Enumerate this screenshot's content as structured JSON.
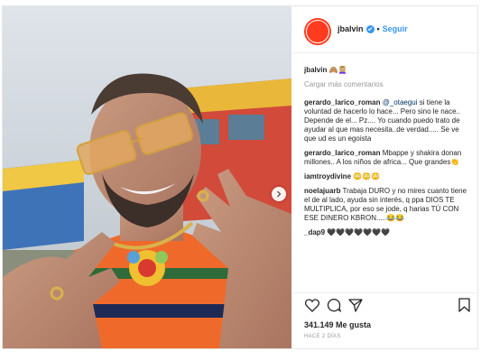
{
  "header": {
    "username": "jbalvin",
    "separator": "•",
    "follow_label": "Seguir"
  },
  "caption": {
    "username": "jbalvin",
    "text": "🙈💆🏼‍♀️"
  },
  "load_more_label": "Cargar más comentarios",
  "comments": [
    {
      "username": "gerardo_larico_roman",
      "mention": "@_otaegui",
      "text": "si tiene la voluntad de hacerlo lo hace... Pero sino le nace.. Depende de el... Pz.... Yo cuando puedo trato de ayudar al que mas necesita..de verdad..... Se ve que ud es un egoista"
    },
    {
      "username": "gerardo_larico_roman",
      "mention": "",
      "text": "Mbappe y shakira donan millones.. A los niños de africa... Que grandes👏"
    },
    {
      "username": "iamtroydivine",
      "mention": "",
      "text": "😳😳😳"
    },
    {
      "username": "noelajuarb",
      "mention": "",
      "text": "Trabaja DURO y no mires cuanto tiene el de al lado, ayuda sin interés, q ppa DIOS TE MULTIPLICA, por eso se jode, q harias TÚ CON ESE DINERO KBRON.....😂😂"
    },
    {
      "username": "_dap9",
      "mention": "",
      "text": "🖤🖤🖤🖤🖤🖤🖤"
    }
  ],
  "likes": "341.149 Me gusta",
  "timestamp": "HACE 2 DÍAS",
  "colors": {
    "accent": "#3897f0",
    "avatar": "#ff3b1f",
    "muted": "#999999"
  },
  "icons": [
    "verified-badge-icon",
    "heart-icon",
    "comment-icon",
    "share-icon",
    "bookmark-icon",
    "chevron-right-icon"
  ]
}
